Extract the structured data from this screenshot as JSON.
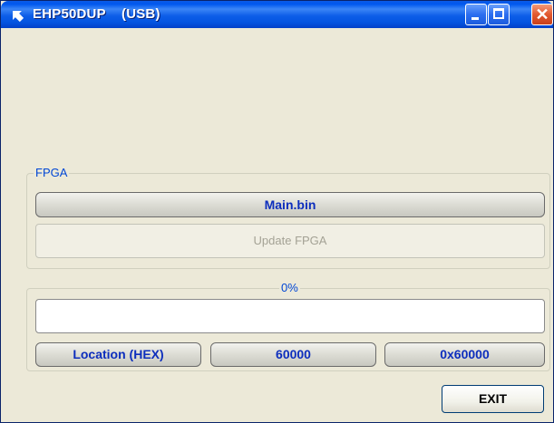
{
  "window": {
    "title": "EHP50DUP    (USB)",
    "icon": "window-arrow-icon"
  },
  "titlebar_buttons": {
    "minimize": "minimize-icon",
    "maximize": "maximize-icon",
    "close": "close-icon",
    "close_glyph": "✕"
  },
  "fpga": {
    "legend": "FPGA",
    "file_label": "Main.bin",
    "update_button": "Update FPGA",
    "update_enabled": false
  },
  "progress": {
    "label": "0%",
    "value": 0
  },
  "location": {
    "label": "Location (HEX)",
    "value": "60000",
    "hex_value": "0x60000"
  },
  "actions": {
    "exit_label": "EXIT"
  },
  "colors": {
    "titlebar": "#0058ee",
    "window_bg": "#ece9d8",
    "label_text": "#0d2ebd",
    "legend_text": "#0046d5"
  }
}
